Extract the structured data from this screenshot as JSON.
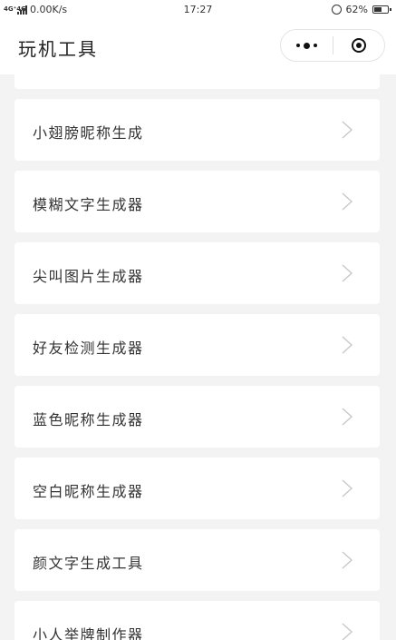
{
  "status_bar": {
    "network": "4G⁺4G",
    "speed": "0.00K/s",
    "time": "17:27",
    "battery": "62%",
    "battery_level": 0.62
  },
  "header": {
    "title": "玩机工具"
  },
  "tools": [
    {
      "label": "小翅膀昵称生成"
    },
    {
      "label": "模糊文字生成器"
    },
    {
      "label": "尖叫图片生成器"
    },
    {
      "label": "好友检测生成器"
    },
    {
      "label": "蓝色昵称生成器"
    },
    {
      "label": "空白昵称生成器"
    },
    {
      "label": "颜文字生成工具"
    },
    {
      "label": "小人举牌制作器"
    }
  ],
  "colors": {
    "background": "#f3f3f3",
    "card": "#ffffff",
    "text": "#333333",
    "chevron": "#c8c8c8"
  },
  "icons": {
    "item_arrow": "chevron-right-icon",
    "more": "more-dots-icon",
    "close": "close-target-icon"
  }
}
